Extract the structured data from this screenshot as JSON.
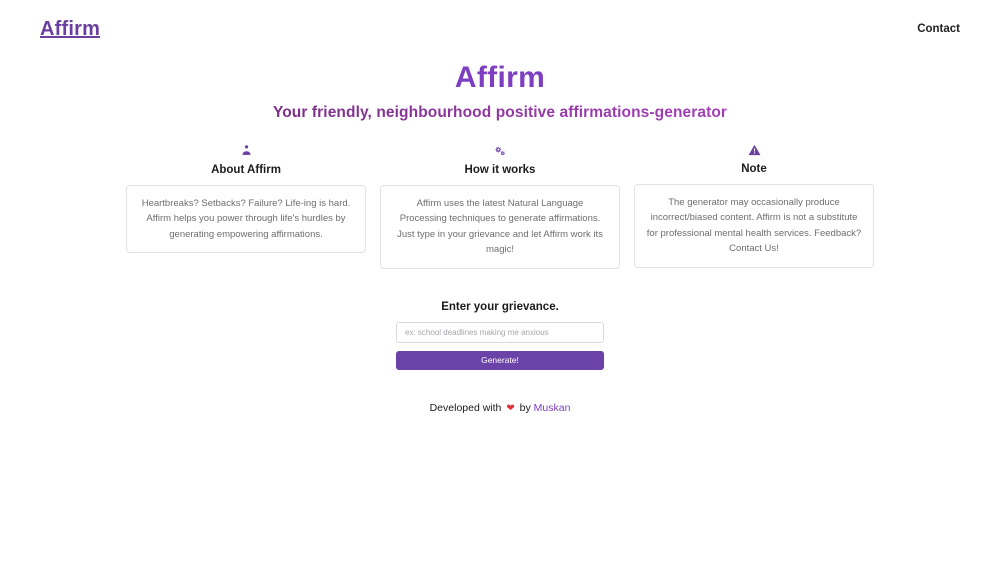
{
  "navbar": {
    "brand": "Affirm",
    "links": [
      {
        "label": "Contact",
        "name": "nav-link-contact"
      }
    ]
  },
  "hero": {
    "title": "Affirm",
    "tagline": "Your friendly, neighbourhood positive affirmations-generator"
  },
  "cards": [
    {
      "icon_glyph": "👩‍💻",
      "icon_name": "person-tech-icon",
      "title": "About Affirm",
      "body": "Heartbreaks? Setbacks? Failure? Life-ing is hard. Affirm helps you power through life's hurdles by generating empowering affirmations."
    },
    {
      "icon_glyph": "⚙",
      "icon_name": "gears-icon",
      "title": "How it works",
      "body": "Affirm uses the latest Natural Language Processing techniques to generate affirmations. Just type in your grievance and let Affirm work its magic!"
    },
    {
      "icon_glyph": "⚠",
      "icon_name": "warning-triangle-icon",
      "title": "Note",
      "body": "The generator may occasionally produce incorrect/biased content. Affirm is not a substitute for professional mental health services. Feedback? Contact Us!"
    }
  ],
  "form": {
    "label": "Enter your grievance.",
    "input_value": "",
    "input_placeholder": "ex: school deadlines making me anxious",
    "submit_label": "Generate!"
  },
  "footer": {
    "prefix": "Developed with",
    "heart": "❤",
    "middle": "by",
    "author": "Muskan"
  },
  "colors": {
    "brand_purple": "#6b3fa0",
    "title_purple": "#7d3fc0",
    "tagline_gradient_start": "#5d2060",
    "tagline_gradient_end": "#b845c8",
    "button_purple": "#6b42a8",
    "heart_red": "#e0323c",
    "card_border": "#e2e2e2",
    "body_text": "#6e6e6e"
  }
}
